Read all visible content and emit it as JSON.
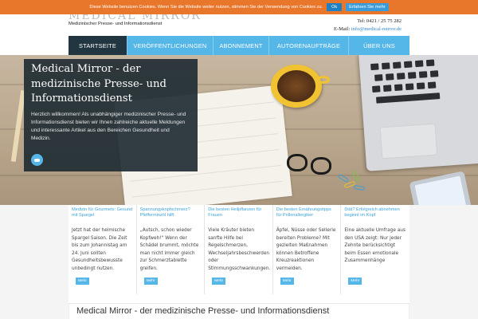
{
  "cookie": {
    "text": "Diese Website benutzen Cookies. Wenn Sie die Website weiter nutzen, stimmen Sie der Verwendung von Cookies zu.",
    "ok_label": "Ok",
    "more_label": "Erfahren Sie mehr"
  },
  "header": {
    "logo": "MEDICAL MIRROR",
    "tagline": "Medizinischer Presse- und Informationsdienst",
    "phone": "Tel: 0421 / 25 75 282",
    "email_label": "E-Mail:",
    "email": "info@medical-mirror.de"
  },
  "nav": {
    "items": [
      "Startseite",
      "Veröffentlichungen",
      "Abonnement",
      "Autorenaufträge",
      "Über uns"
    ]
  },
  "hero": {
    "title": "Medical Mirror - der medizinische Presse- und Informationsdienst",
    "text": "Herzlich willkommen! Als unabhängiger medizinischer Presse- und Informationsdienst bieten wir Ihnen zahlreiche aktuelle Meldungen und interessante Artikel aus den Bereichen Gesundheit und Medizin."
  },
  "teasers": [
    {
      "title": "Medizin für Gourmets: Gesund mit Spargel",
      "text": "Jetzt hat der heimische Spargel Saison. Die Zeit bis zum Johannistag am 24. Juni sollten Gesundheitsbewusste unbedingt nutzen.",
      "button": "Mehr"
    },
    {
      "title": "Spannungskopfschmerz? Pfefferminzöl hilft",
      "text": "„Autsch, schon wieder Kopfweh!\" Wenn der Schädel brummt, möchte man nicht immer gleich zur Schmerztablette greifen.",
      "button": "Mehr"
    },
    {
      "title": "Die besten Heilpflanzen für Frauen",
      "text": "Viele Kräuter bieten sanfte Hilfe bei Regelschmerzen, Wechseljahrsbeschwerden oder Stimmungsschwankungen.",
      "button": "Mehr"
    },
    {
      "title": "Die besten Ernährungstipps für Pollenallergiker",
      "text": "Äpfel, Nüsse oder Sellerie bereiten Probleme? Mit gezielten Maßnahmen können Betroffene Kreuzreaktionen vermeiden.",
      "button": "Mehr"
    },
    {
      "title": "Diät? Erfolgreich abnehmen beginnt im Kopf",
      "text": "Eine aktuelle Umfrage aus den USA zeigt: Nur jeder Zehnte berücksichtigt beim Essen emotionale Zusammenhänge",
      "button": "Mehr"
    }
  ],
  "section": {
    "title": "Medical Mirror - der medizinische Presse- und Informationsdienst"
  },
  "colors": {
    "cookie_bar": "#e8772c",
    "nav": "#55b6e8",
    "nav_active": "#223642",
    "link": "#3ea3d8"
  }
}
